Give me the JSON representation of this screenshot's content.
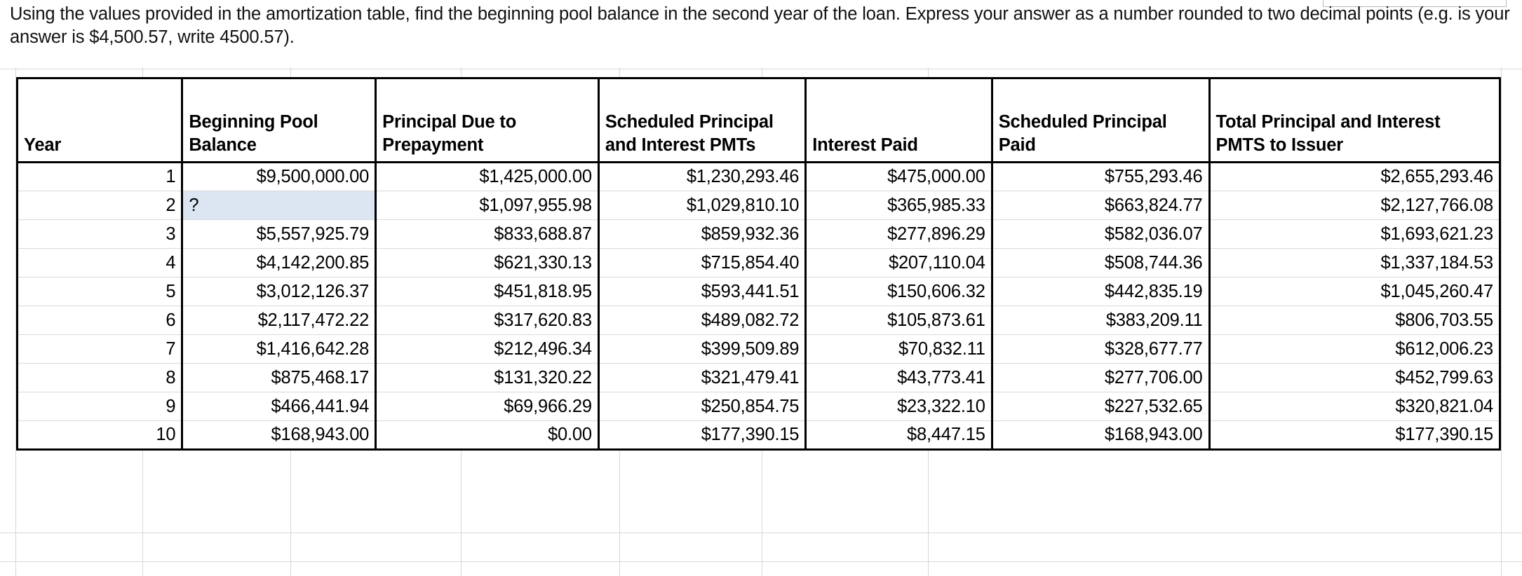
{
  "prompt": {
    "text": "Using the values provided in the amortization table, find the beginning pool balance in the second year of the loan. Express your answer as a number rounded to two decimal points (e.g. is your answer is $4,500.57, write 4500.57)."
  },
  "colors": {
    "missing_cell_highlight": "#dce6f2",
    "table_border": "#000000",
    "row_divider": "#d9d9d9",
    "sheet_gridline": "#d7d7d7"
  },
  "table": {
    "headers": [
      "Year",
      "Beginning Pool Balance",
      "Principal Due to Prepayment",
      "Scheduled Principal and Interest PMTs",
      "Interest Paid",
      "Scheduled Principal Paid",
      "Total Principal and Interest PMTS to Issuer"
    ],
    "rows": [
      {
        "year": "1",
        "beginning_pool_balance": "$9,500,000.00",
        "principal_due_to_prepayment": "$1,425,000.00",
        "scheduled_pi_pmts": "$1,230,293.46",
        "interest_paid": "$475,000.00",
        "scheduled_principal_paid": "$755,293.46",
        "total_pi_pmts_to_issuer": "$2,655,293.46"
      },
      {
        "year": "2",
        "beginning_pool_balance": "?",
        "principal_due_to_prepayment": "$1,097,955.98",
        "scheduled_pi_pmts": "$1,029,810.10",
        "interest_paid": "$365,985.33",
        "scheduled_principal_paid": "$663,824.77",
        "total_pi_pmts_to_issuer": "$2,127,766.08"
      },
      {
        "year": "3",
        "beginning_pool_balance": "$5,557,925.79",
        "principal_due_to_prepayment": "$833,688.87",
        "scheduled_pi_pmts": "$859,932.36",
        "interest_paid": "$277,896.29",
        "scheduled_principal_paid": "$582,036.07",
        "total_pi_pmts_to_issuer": "$1,693,621.23"
      },
      {
        "year": "4",
        "beginning_pool_balance": "$4,142,200.85",
        "principal_due_to_prepayment": "$621,330.13",
        "scheduled_pi_pmts": "$715,854.40",
        "interest_paid": "$207,110.04",
        "scheduled_principal_paid": "$508,744.36",
        "total_pi_pmts_to_issuer": "$1,337,184.53"
      },
      {
        "year": "5",
        "beginning_pool_balance": "$3,012,126.37",
        "principal_due_to_prepayment": "$451,818.95",
        "scheduled_pi_pmts": "$593,441.51",
        "interest_paid": "$150,606.32",
        "scheduled_principal_paid": "$442,835.19",
        "total_pi_pmts_to_issuer": "$1,045,260.47"
      },
      {
        "year": "6",
        "beginning_pool_balance": "$2,117,472.22",
        "principal_due_to_prepayment": "$317,620.83",
        "scheduled_pi_pmts": "$489,082.72",
        "interest_paid": "$105,873.61",
        "scheduled_principal_paid": "$383,209.11",
        "total_pi_pmts_to_issuer": "$806,703.55"
      },
      {
        "year": "7",
        "beginning_pool_balance": "$1,416,642.28",
        "principal_due_to_prepayment": "$212,496.34",
        "scheduled_pi_pmts": "$399,509.89",
        "interest_paid": "$70,832.11",
        "scheduled_principal_paid": "$328,677.77",
        "total_pi_pmts_to_issuer": "$612,006.23"
      },
      {
        "year": "8",
        "beginning_pool_balance": "$875,468.17",
        "principal_due_to_prepayment": "$131,320.22",
        "scheduled_pi_pmts": "$321,479.41",
        "interest_paid": "$43,773.41",
        "scheduled_principal_paid": "$277,706.00",
        "total_pi_pmts_to_issuer": "$452,799.63"
      },
      {
        "year": "9",
        "beginning_pool_balance": "$466,441.94",
        "principal_due_to_prepayment": "$69,966.29",
        "scheduled_pi_pmts": "$250,854.75",
        "interest_paid": "$23,322.10",
        "scheduled_principal_paid": "$227,532.65",
        "total_pi_pmts_to_issuer": "$320,821.04"
      },
      {
        "year": "10",
        "beginning_pool_balance": "$168,943.00",
        "principal_due_to_prepayment": "$0.00",
        "scheduled_pi_pmts": "$177,390.15",
        "interest_paid": "$8,447.15",
        "scheduled_principal_paid": "$168,943.00",
        "total_pi_pmts_to_issuer": "$177,390.15"
      }
    ]
  }
}
